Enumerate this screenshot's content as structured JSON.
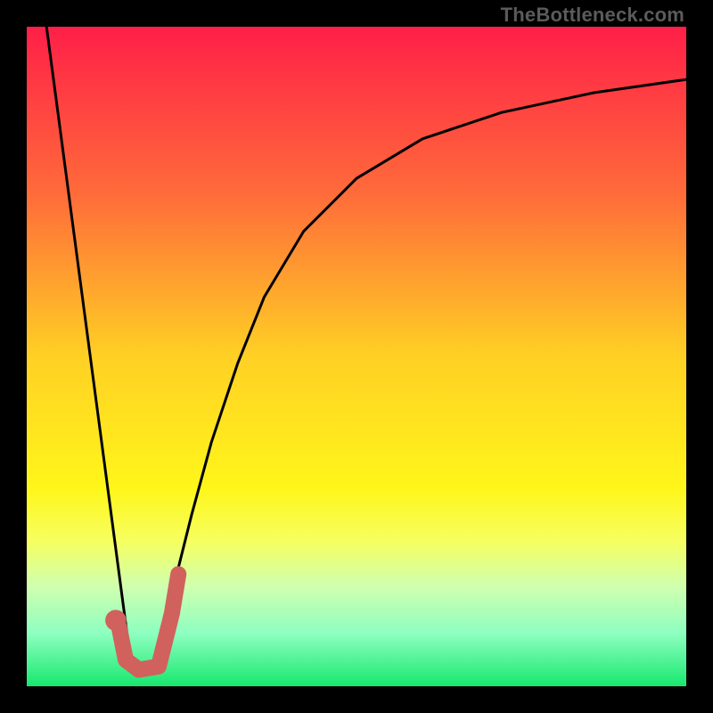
{
  "watermark": "TheBottleneck.com",
  "chart_data": {
    "type": "line",
    "title": "",
    "xlabel": "",
    "ylabel": "",
    "xlim": [
      0,
      100
    ],
    "ylim": [
      0,
      100
    ],
    "grid": false,
    "gradient": {
      "stops": [
        {
          "offset": 0.0,
          "color": "#ff1f48"
        },
        {
          "offset": 0.25,
          "color": "#ff6a3a"
        },
        {
          "offset": 0.5,
          "color": "#ffd024"
        },
        {
          "offset": 0.7,
          "color": "#fff61a"
        },
        {
          "offset": 0.78,
          "color": "#f6ff60"
        },
        {
          "offset": 0.85,
          "color": "#cfffb0"
        },
        {
          "offset": 0.92,
          "color": "#8dffc0"
        },
        {
          "offset": 1.0,
          "color": "#17e86e"
        }
      ]
    },
    "series": [
      {
        "name": "left-limb",
        "stroke": "#000000",
        "stroke_width": 3,
        "x": [
          3,
          16
        ],
        "y": [
          100,
          2
        ]
      },
      {
        "name": "right-limb",
        "stroke": "#000000",
        "stroke_width": 3,
        "x": [
          19,
          22,
          25,
          28,
          32,
          36,
          42,
          50,
          60,
          72,
          86,
          100
        ],
        "y": [
          2,
          14,
          26,
          37,
          49,
          59,
          69,
          77,
          83,
          87,
          90,
          92
        ]
      }
    ],
    "highlight": {
      "name": "selected-region",
      "stroke": "#d1615d",
      "stroke_width": 18,
      "points_xy": [
        [
          14,
          9
        ],
        [
          15,
          4
        ],
        [
          17,
          2.5
        ],
        [
          20,
          3
        ],
        [
          22,
          11
        ],
        [
          23,
          17
        ]
      ]
    },
    "marker": {
      "name": "selected-point",
      "fill": "#d1615d",
      "cx": 13.5,
      "cy": 10,
      "r": 1.6
    }
  }
}
